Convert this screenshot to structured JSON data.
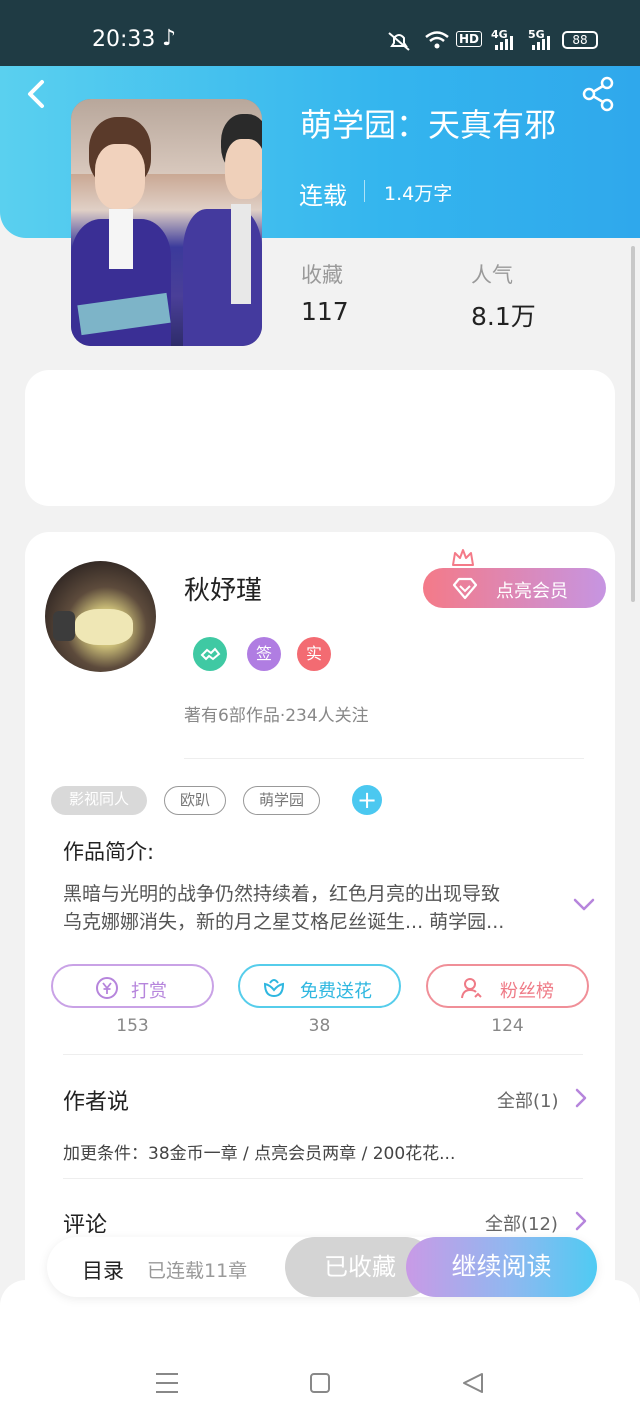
{
  "status_bar": {
    "time": "20:33",
    "app_icon": "tiktok-icon",
    "indicators": [
      "mute-icon",
      "wifi-icon",
      "HD",
      "4G",
      "5G"
    ],
    "battery": "88"
  },
  "header": {
    "back_icon": "back-arrow-icon",
    "share_icon": "share-icon",
    "book_title": "萌学园：天真有邪",
    "status": "连载",
    "word_count": "1.4万字",
    "stats": [
      {
        "label": "收藏",
        "value": "117"
      },
      {
        "label": "人气",
        "value": "8.1万"
      }
    ]
  },
  "author": {
    "name": "秋妤瑾",
    "vip_button": "点亮会员",
    "badges": [
      {
        "text": "",
        "icon": "handshake-icon",
        "color": "#3fc9a3"
      },
      {
        "text": "签",
        "color": "#b07de2"
      },
      {
        "text": "实",
        "color": "#f36b72"
      }
    ],
    "stats": "著有6部作品·234人关注"
  },
  "tags": [
    "影视同人",
    "欧趴",
    "萌学园"
  ],
  "intro": {
    "heading": "作品简介:",
    "lines": [
      "黑暗与光明的战争仍然持续着，红色月亮的出现导致",
      "乌克娜娜消失，新的月之星艾格尼丝诞生... 萌学园..."
    ]
  },
  "actions": [
    {
      "label": "打赏",
      "icon": "yen-coin-icon",
      "count": "153"
    },
    {
      "label": "免费送花",
      "icon": "flower-icon",
      "count": "38"
    },
    {
      "label": "粉丝榜",
      "icon": "fan-ranking-icon",
      "count": "124"
    }
  ],
  "author_says": {
    "heading": "作者说",
    "link": "全部(1)",
    "text": "加更条件：38金币一章 / 点亮会员两章 / 200花花..."
  },
  "comments": {
    "heading": "评论",
    "link": "全部(12)"
  },
  "bottom_bar": {
    "toc": "目录",
    "chapters": "已连载11章",
    "collected": "已收藏",
    "read": "继续阅读"
  },
  "colors": {
    "header_gradient": [
      "#5ad0ef",
      "#2fa8ec"
    ],
    "vip_gradient": [
      "#f47a88",
      "#c695e2"
    ],
    "tip_color": "#b685dc",
    "flower_color": "#2fb7e0",
    "fans_color": "#ef7b87"
  }
}
